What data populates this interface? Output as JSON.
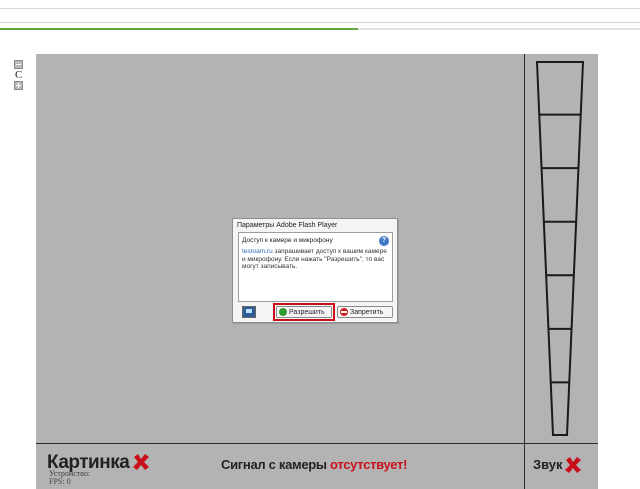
{
  "colors": {
    "stage": "#b3b3b3",
    "progress": "#5ea53a",
    "warning": "#c8101a",
    "link": "#2a6bb5"
  },
  "loading": {
    "progress_fraction": 0.56
  },
  "zoom": {
    "center_label": "C",
    "minus_icon": "minus-icon",
    "plus_icon": "plus-icon"
  },
  "footer": {
    "picture_label": "Картинка",
    "device_text": "Устройство:",
    "fps_text": "FPS: 0",
    "signal_prefix": "Сигнал с камеры ",
    "signal_status": "отсутствует!",
    "sound_label": "Звук",
    "close_icon": "close-x-icon"
  },
  "sound_meter": {
    "segments": 7
  },
  "flash_dialog": {
    "title": "Параметры Adobe Flash Player",
    "heading": "Доступ к камере и микрофону",
    "site": "testoam.ru",
    "message_rest": " запрашивает доступ к вашим камере и микрофону. Если нажать \"Разрешить\", то вас могут записывать.",
    "allow_label": "Разрешить",
    "deny_label": "Запретить",
    "help_icon": "help-icon",
    "settings_icon": "monitor-icon"
  }
}
